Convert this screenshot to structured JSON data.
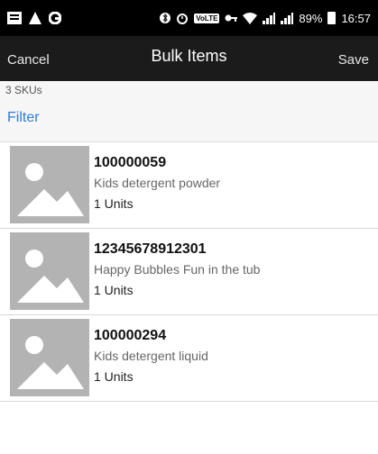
{
  "status_bar": {
    "left_icons": [
      "message-icon",
      "a-app-icon",
      "g-app-icon"
    ],
    "right_icons": [
      "bluetooth-icon",
      "alarm-icon",
      "volte-icon",
      "key-icon",
      "wifi-icon",
      "signal-icon",
      "signal-icon"
    ],
    "volte_label": "VoLTE",
    "battery": "89%",
    "time": "16:57"
  },
  "nav": {
    "cancel_label": "Cancel",
    "title": "Bulk Items",
    "save_label": "Save"
  },
  "subheader": {
    "sku_count": "3 SKUs",
    "filter_label": "Filter"
  },
  "items": [
    {
      "id": "100000059",
      "description": "Kids detergent powder",
      "units": "1 Units",
      "image": "placeholder-image-icon"
    },
    {
      "id": "12345678912301",
      "description": "Happy Bubbles Fun in the tub",
      "units": "1 Units",
      "image": "placeholder-image-icon"
    },
    {
      "id": "100000294",
      "description": "Kids detergent liquid",
      "units": "1 Units",
      "image": "placeholder-image-icon"
    }
  ],
  "colors": {
    "status_bar_bg": "#000000",
    "nav_bg": "#1b1b1b",
    "filter_link": "#2f7bd6",
    "placeholder_bg": "#b3b3b3"
  }
}
